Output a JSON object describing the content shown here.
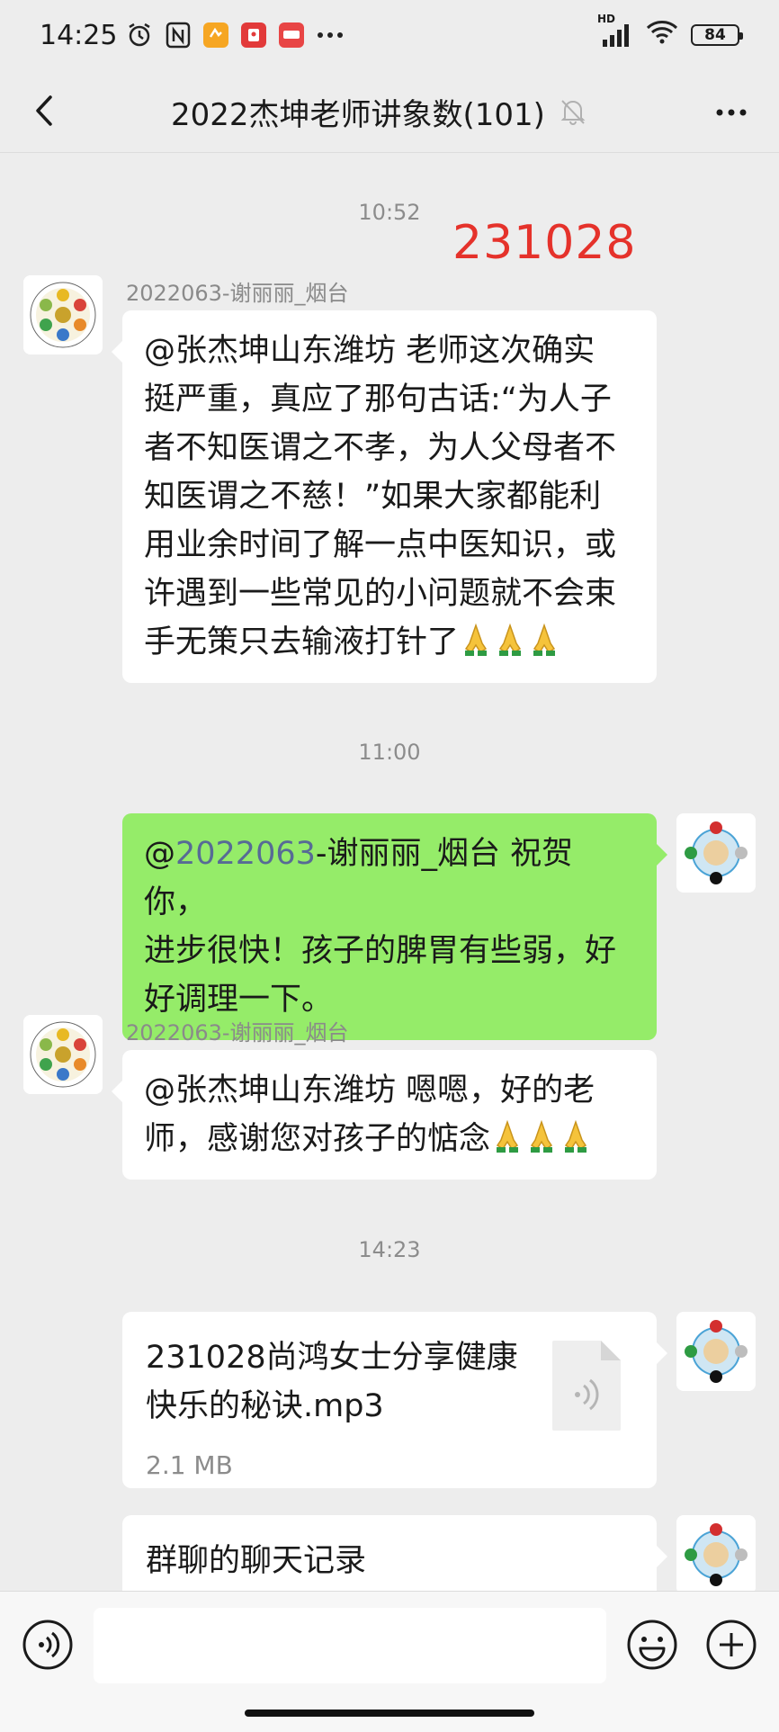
{
  "status_bar": {
    "time": "14:25",
    "network": "HD",
    "battery": "84"
  },
  "header": {
    "title": "2022杰坤老师讲象数(101)",
    "icons": [
      "back-arrow-icon",
      "mute-bell-icon",
      "more-icon"
    ]
  },
  "stamp": "231028",
  "messages": [
    {
      "type": "timestamp",
      "text": "10:52"
    },
    {
      "type": "incoming",
      "sender": "2022063-谢丽丽_烟台",
      "lines": [
        "@张杰坤山东潍坊  老师这次确实",
        "挺严重，真应了那句古话:“为人子",
        "者不知医谓之不孝，为人父母者不",
        "知医谓之不慈！”如果大家都能利",
        "用业余时间了解一点中医知识，或",
        "许遇到一些常见的小问题就不会束",
        "手无策只去输液打针了"
      ]
    },
    {
      "type": "timestamp",
      "text": "11:00"
    },
    {
      "type": "outgoing",
      "prefix": "@",
      "mention": "2022063",
      "line1_rest": "-谢丽丽_烟台  祝贺你，",
      "lines": [
        "进步很快！孩子的脾胃有些弱，好",
        "好调理一下。"
      ]
    },
    {
      "type": "incoming",
      "sender": "2022063-谢丽丽_烟台",
      "lines": [
        "@张杰坤山东潍坊  嗯嗯，好的老",
        "师，感谢您对孩子的惦念"
      ]
    },
    {
      "type": "timestamp",
      "text": "14:23"
    },
    {
      "type": "file",
      "name_lines": [
        "231028尚鸿女士分享健康",
        "快乐的秘诀.mp3"
      ],
      "size": "2.1 MB"
    },
    {
      "type": "record",
      "text": "群聊的聊天记录"
    }
  ],
  "input_bar": {
    "placeholder": "",
    "icons": [
      "voice-icon",
      "emoji-icon",
      "plus-icon"
    ]
  },
  "colors": {
    "background": "#ededed",
    "outgoing_bubble": "#95ec69",
    "stamp": "#e5322b",
    "mention": "#576b95"
  }
}
